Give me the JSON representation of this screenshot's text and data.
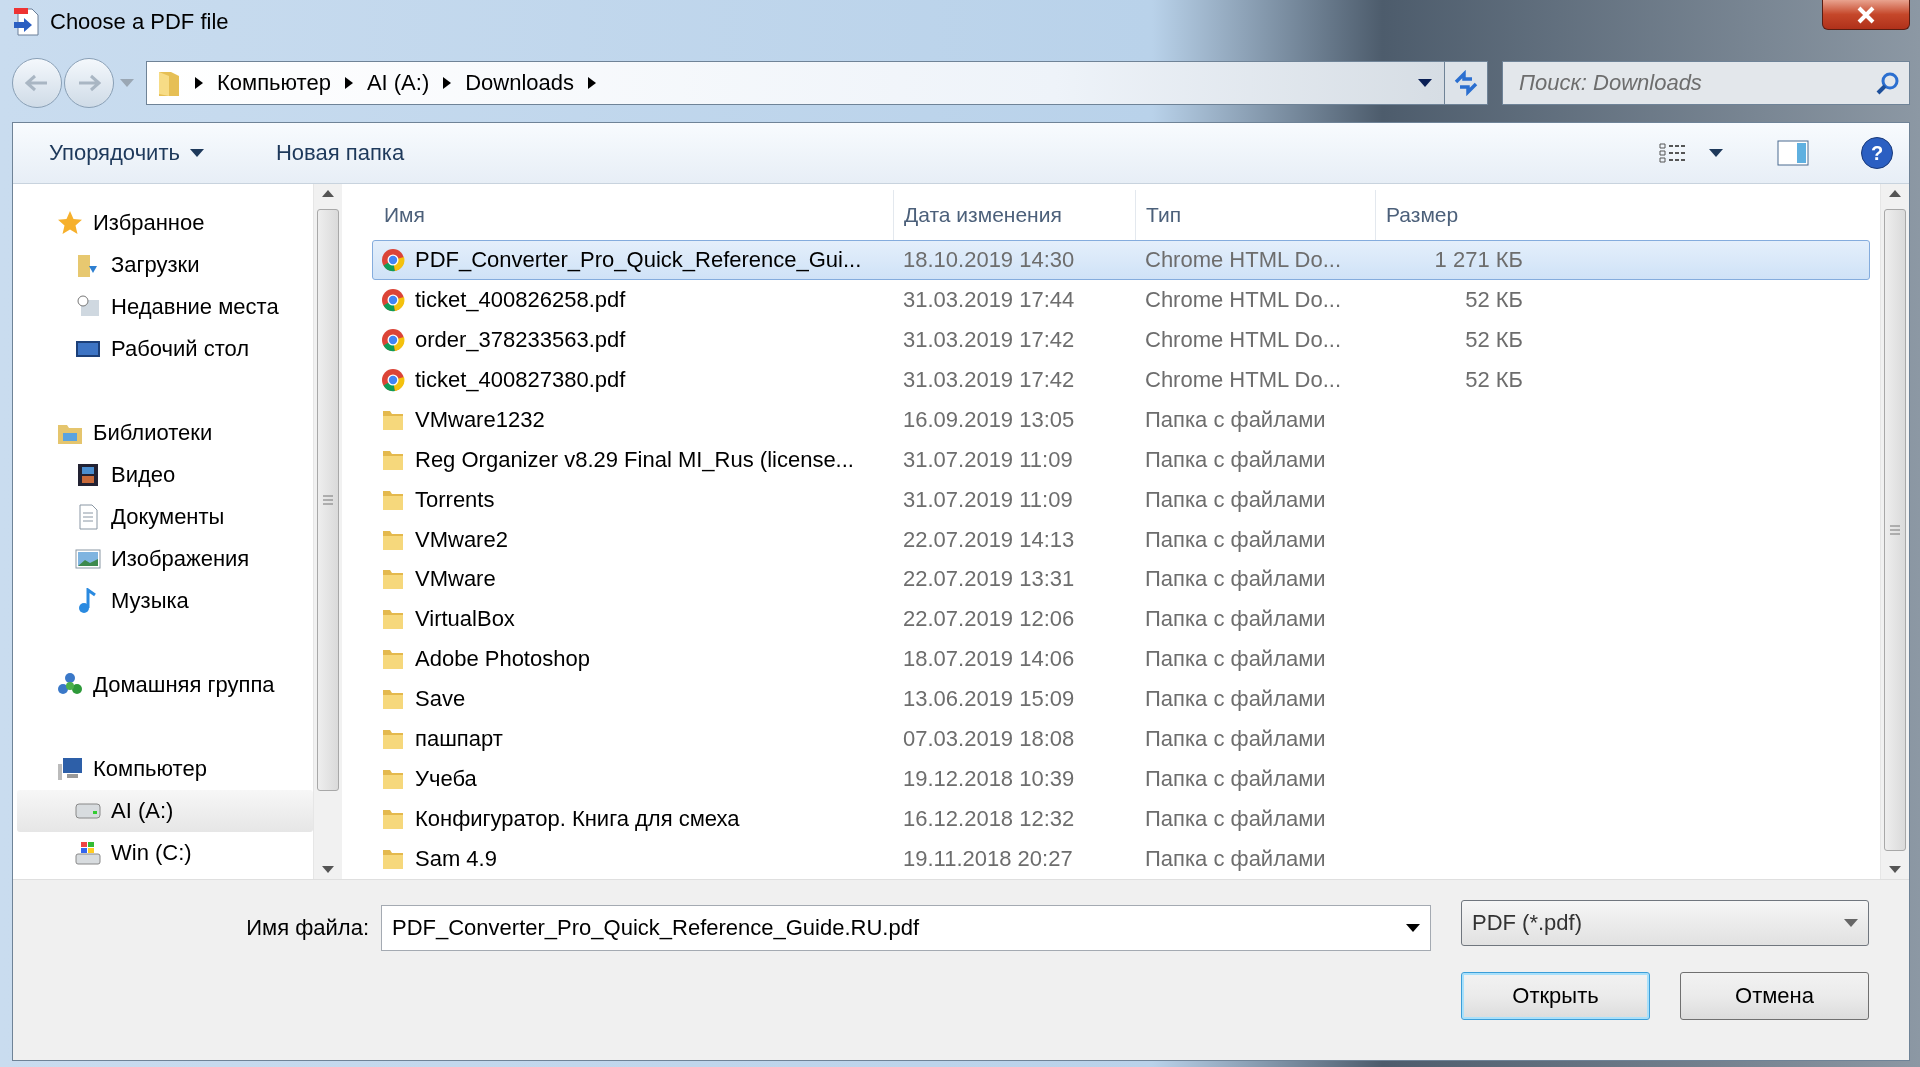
{
  "window": {
    "title": "Choose a PDF file"
  },
  "breadcrumb": [
    "Компьютер",
    "AI (A:)",
    "Downloads"
  ],
  "search": {
    "placeholder": "Поиск: Downloads"
  },
  "toolbar": {
    "organize": "Упорядочить",
    "new_folder": "Новая папка",
    "help": "?"
  },
  "sidebar": [
    {
      "label": "Избранное",
      "kind": "star",
      "selected": false,
      "children": [
        {
          "label": "Загрузки",
          "kind": "downloads",
          "selected": false
        },
        {
          "label": "Недавние места",
          "kind": "recent",
          "selected": false
        },
        {
          "label": "Рабочий стол",
          "kind": "desktop",
          "selected": false
        }
      ]
    },
    {
      "label": "Библиотеки",
      "kind": "library",
      "selected": false,
      "children": [
        {
          "label": "Видео",
          "kind": "video",
          "selected": false
        },
        {
          "label": "Документы",
          "kind": "docs",
          "selected": false
        },
        {
          "label": "Изображения",
          "kind": "images",
          "selected": false
        },
        {
          "label": "Музыка",
          "kind": "music",
          "selected": false
        }
      ]
    },
    {
      "label": "Домашняя группа",
      "kind": "homegroup",
      "selected": false
    },
    {
      "label": "Компьютер",
      "kind": "computer",
      "selected": false,
      "children": [
        {
          "label": "AI (A:)",
          "kind": "drive",
          "selected": true
        },
        {
          "label": "Win (C:)",
          "kind": "windrive",
          "selected": false
        }
      ]
    }
  ],
  "columns": [
    "Имя",
    "Дата изменения",
    "Тип",
    "Размер"
  ],
  "files": [
    {
      "kind": "chrome",
      "name": "PDF_Converter_Pro_Quick_Reference_Gui...",
      "date": "18.10.2019 14:30",
      "type": "Chrome HTML Do...",
      "size": "1 271 КБ",
      "selected": true
    },
    {
      "kind": "chrome",
      "name": "ticket_400826258.pdf",
      "date": "31.03.2019 17:44",
      "type": "Chrome HTML Do...",
      "size": "52 КБ",
      "selected": false
    },
    {
      "kind": "chrome",
      "name": "order_378233563.pdf",
      "date": "31.03.2019 17:42",
      "type": "Chrome HTML Do...",
      "size": "52 КБ",
      "selected": false
    },
    {
      "kind": "chrome",
      "name": "ticket_400827380.pdf",
      "date": "31.03.2019 17:42",
      "type": "Chrome HTML Do...",
      "size": "52 КБ",
      "selected": false
    },
    {
      "kind": "folder",
      "name": "VMware1232",
      "date": "16.09.2019 13:05",
      "type": "Папка с файлами",
      "selected": false
    },
    {
      "kind": "folder",
      "name": "Reg Organizer v8.29 Final MI_Rus (license...",
      "date": "31.07.2019 11:09",
      "type": "Папка с файлами",
      "selected": false
    },
    {
      "kind": "folder",
      "name": "Torrents",
      "date": "31.07.2019 11:09",
      "type": "Папка с файлами",
      "selected": false
    },
    {
      "kind": "folder",
      "name": "VMware2",
      "date": "22.07.2019 14:13",
      "type": "Папка с файлами",
      "selected": false
    },
    {
      "kind": "folder",
      "name": "VMware",
      "date": "22.07.2019 13:31",
      "type": "Папка с файлами",
      "selected": false
    },
    {
      "kind": "folder",
      "name": "VirtualBox",
      "date": "22.07.2019 12:06",
      "type": "Папка с файлами",
      "selected": false
    },
    {
      "kind": "folder",
      "name": "Adobe Photoshop",
      "date": "18.07.2019 14:06",
      "type": "Папка с файлами",
      "selected": false
    },
    {
      "kind": "folder",
      "name": "Save",
      "date": "13.06.2019 15:09",
      "type": "Папка с файлами",
      "selected": false
    },
    {
      "kind": "folder",
      "name": "пашпарт",
      "date": "07.03.2019 18:08",
      "type": "Папка с файлами",
      "selected": false
    },
    {
      "kind": "folder",
      "name": "Учеба",
      "date": "19.12.2018 10:39",
      "type": "Папка с файлами",
      "selected": false
    },
    {
      "kind": "folder",
      "name": "Конфигуратор. Книга для смеха",
      "date": "16.12.2018 12:32",
      "type": "Папка с файлами",
      "selected": false
    },
    {
      "kind": "folder",
      "name": "Sam 4.9",
      "date": "19.11.2018 20:27",
      "type": "Папка с файлами",
      "selected": false
    }
  ],
  "footer": {
    "filename_label": "Имя файла:",
    "filename": "PDF_Converter_Pro_Quick_Reference_Guide.RU.pdf",
    "filter": "PDF (*.pdf)",
    "open": "Открыть",
    "cancel": "Отмена"
  }
}
